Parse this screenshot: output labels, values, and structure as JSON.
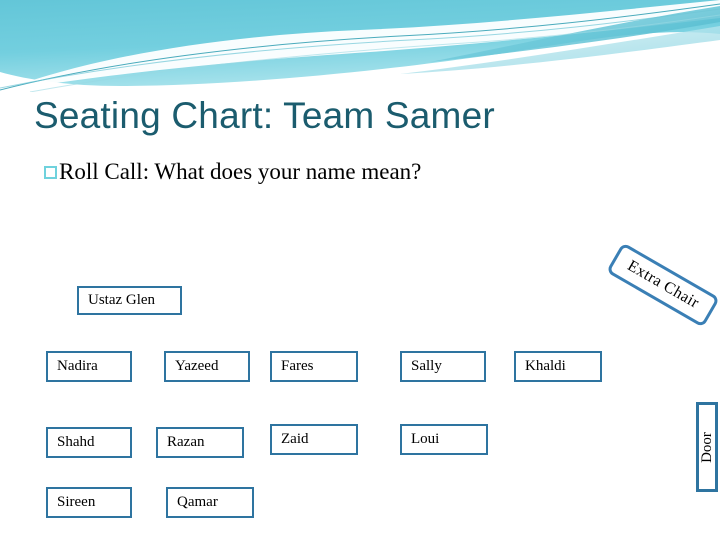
{
  "slide": {
    "title": "Seating Chart: Team Samer",
    "bullet": {
      "glyph": "empty-square-bullet",
      "text": "Roll Call: What does your name mean?"
    },
    "teacher_seat": {
      "label": "Ustaz Glen"
    },
    "seat_rows": [
      [
        {
          "label": "Nadira"
        },
        {
          "label": "Yazeed"
        },
        {
          "label": "Fares"
        },
        {
          "label": "Sally"
        },
        {
          "label": "Khaldi"
        }
      ],
      [
        {
          "label": "Shahd"
        },
        {
          "label": "Razan"
        },
        {
          "label": "Zaid"
        },
        {
          "label": "Loui"
        }
      ],
      [
        {
          "label": "Sireen"
        },
        {
          "label": "Qamar"
        }
      ]
    ],
    "extra_chair": {
      "label": "Extra Chair"
    },
    "door": {
      "label": "Door"
    },
    "colors": {
      "title_text": "#1b5c6e",
      "bullet_marker": "#6fd2dd",
      "seat_border": "#2e74a0",
      "extra_chair_border": "#3a7fb5",
      "body_text": "#000000",
      "background": "#ffffff",
      "header_wave_dark": "#3fb8cc",
      "header_wave_mid": "#7fd2e0",
      "header_wave_light": "#bfe8ef"
    }
  }
}
